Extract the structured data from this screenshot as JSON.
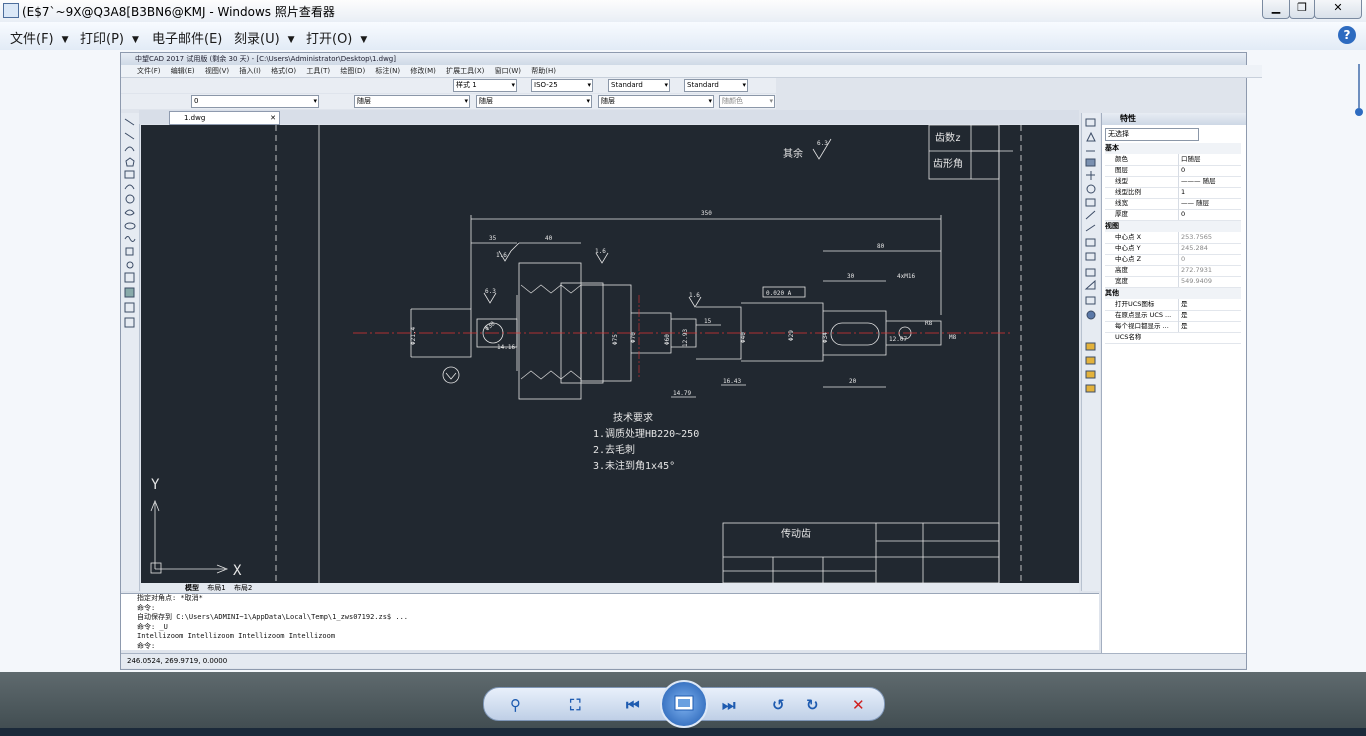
{
  "window": {
    "title": "(E$7`~9X@Q3A8[B3BN6@KMJ - Windows 照片查看器",
    "minimize": "▁",
    "maximize": "❐",
    "close": "✕"
  },
  "viewer_menu": {
    "file": "文件(F)",
    "print": "打印(P)",
    "email": "电子邮件(E)",
    "burn": "刻录(U)",
    "open": "打开(O)",
    "help": "?"
  },
  "cad": {
    "title": "中望CAD 2017 试用版 (剩余 30 天) - [C:\\Users\\Administrator\\Desktop\\1.dwg]",
    "menu": [
      "文件(F)",
      "编辑(E)",
      "视图(V)",
      "插入(I)",
      "格式(O)",
      "工具(T)",
      "绘图(D)",
      "标注(N)",
      "修改(M)",
      "扩展工具(X)",
      "窗口(W)",
      "帮助(H)"
    ],
    "toolbar": {
      "text_style": "样式 1",
      "dim_style": "ISO-25",
      "table_style": "Standard",
      "multileader_style": "Standard",
      "layer": "0",
      "color": "随层",
      "linetype": "随层",
      "lineweight": "随层",
      "plotstyle": "随颜色"
    },
    "tab_file": "1.dwg",
    "layout_tabs": {
      "model": "模型",
      "layout1": "布局1",
      "layout2": "布局2"
    },
    "drawing": {
      "title_block_1": "齿数z",
      "title_block_2": "齿形角",
      "rest_label": "其余",
      "rest_roughness": "6.3",
      "part_name": "传动齿",
      "tech_title": "技术要求",
      "tech_1": "1.调质处理HB220~250",
      "tech_2": "2.去毛刺",
      "tech_3": "3.未注到角1x45°",
      "dims": {
        "overall": "350",
        "d35": "35",
        "d40": "40",
        "d80": "80",
        "d30": "30",
        "d20": "20",
        "d15": "15",
        "d16_43": "16.43",
        "d14_79": "14.79",
        "d14_16": "14.16",
        "d12_07": "12.07",
        "d_4xM16": "4xM16",
        "d_tol": "0.020 A",
        "d_phi21_4": "Φ21.4",
        "d_phi75": "Φ75",
        "d_phi70": "Φ70",
        "d_phi60": "Φ60",
        "d_phi40": "Φ40",
        "d_phi29": "Φ29",
        "d_m8": "M8",
        "d_r8": "R8",
        "d_1_6": "1.6",
        "d_6_3": "6.3",
        "d_12_93": "12.93",
        "d_phi30": "Φ30",
        "d_phi34": "Φ34"
      },
      "axis_y": "Y",
      "axis_x": "X"
    },
    "command": {
      "l1": "指定对角点: *取消*",
      "l2": "命令:",
      "l3": "自动保存到 C:\\Users\\ADMINI~1\\AppData\\Local\\Temp\\1_zws07192.zs$ ...",
      "l4": "命令: _U",
      "l5": "Intellizoom Intellizoom Intellizoom Intellizoom",
      "l6": "命令:"
    },
    "coords": "246.0524, 269.9719, 0.0000",
    "props": {
      "title": "特性",
      "selection": "无选择",
      "groups": {
        "basic": "基本",
        "view": "视图",
        "misc": "其他"
      },
      "rows": [
        {
          "k": "颜色",
          "v": "口随层"
        },
        {
          "k": "图层",
          "v": "0"
        },
        {
          "k": "线型",
          "v": "——— 随层"
        },
        {
          "k": "线型比例",
          "v": "1"
        },
        {
          "k": "线宽",
          "v": "—— 随层"
        },
        {
          "k": "厚度",
          "v": "0"
        }
      ],
      "view_rows": [
        {
          "k": "中心点 X",
          "v": "253.7565"
        },
        {
          "k": "中心点 Y",
          "v": "245.284"
        },
        {
          "k": "中心点 Z",
          "v": "0"
        },
        {
          "k": "高度",
          "v": "272.7931"
        },
        {
          "k": "宽度",
          "v": "549.9409"
        }
      ],
      "misc_rows": [
        {
          "k": "打开UCS图标",
          "v": "是"
        },
        {
          "k": "在原点显示 UCS ...",
          "v": "是"
        },
        {
          "k": "每个视口都显示 ...",
          "v": "是"
        },
        {
          "k": "UCS名称",
          "v": ""
        }
      ]
    }
  }
}
